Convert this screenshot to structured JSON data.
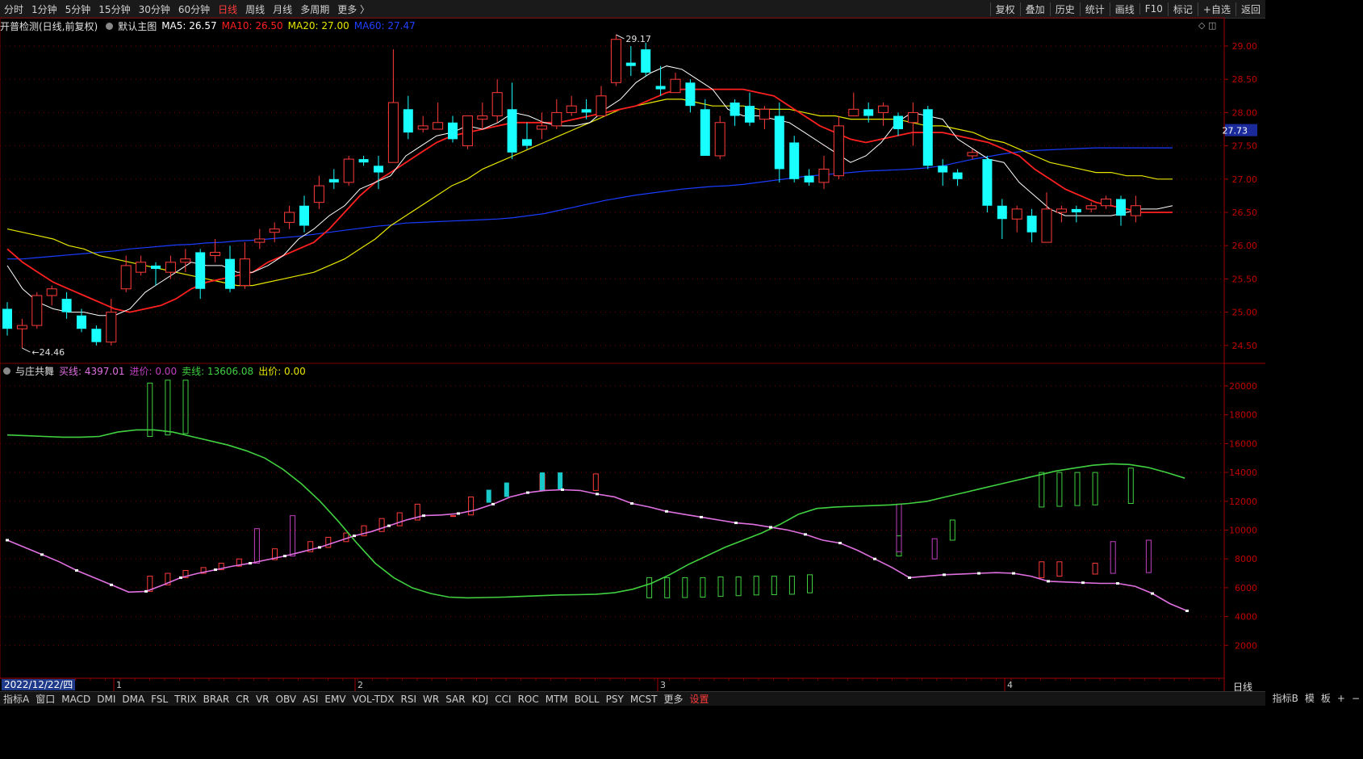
{
  "topbar": {
    "periods": [
      "分时",
      "1分钟",
      "5分钟",
      "15分钟",
      "30分钟",
      "60分钟",
      "日线",
      "周线",
      "月线",
      "多周期",
      "更多 〉"
    ],
    "active_period": "日线",
    "tools": [
      "复权",
      "叠加",
      "历史",
      "统计",
      "画线",
      "F10",
      "标记",
      "+自选",
      "返回"
    ]
  },
  "main_legend": {
    "stock": "开普检测(日线,前复权)",
    "chart_name": "默认主图",
    "ma5": "MA5: 26.57",
    "ma10": "MA10: 26.50",
    "ma20": "MA20: 27.00",
    "ma60": "MA60: 27.47"
  },
  "indicator_legend": {
    "name": "与庄共舞",
    "buy": "买线: 4397.01",
    "in": "进价: 0.00",
    "sell": "卖线: 13606.08",
    "out": "出价: 0.00"
  },
  "colors": {
    "up": "#ff3b3b",
    "down": "#19ffff",
    "ma5": "#ffffff",
    "ma10": "#ff2020",
    "ma20": "#e6e600",
    "ma60": "#1a3cff",
    "buy_line": "#e070e0",
    "sell_line": "#40d040"
  },
  "price_axis": {
    "labels": [
      "29.00",
      "28.50",
      "28.00",
      "27.50",
      "27.00",
      "26.50",
      "26.00",
      "25.50",
      "25.00",
      "24.50"
    ],
    "current": "27.73",
    "high_annot": "29.17",
    "low_annot": "24.46"
  },
  "ind_axis": {
    "labels": [
      "20000",
      "18000",
      "16000",
      "14000",
      "12000",
      "10000",
      "8000",
      "6000",
      "4000",
      "2000"
    ]
  },
  "time_axis": {
    "date": "2022/12/22/四",
    "months": [
      "1",
      "2",
      "3",
      "4"
    ],
    "period_label": "日线"
  },
  "chart_data": {
    "type": "candlestick",
    "candles": [
      [
        25.05,
        24.75,
        25.15,
        24.65
      ],
      [
        24.75,
        24.8,
        24.9,
        24.46
      ],
      [
        24.8,
        25.25,
        25.3,
        24.75
      ],
      [
        25.25,
        25.35,
        25.4,
        25.1
      ],
      [
        25.2,
        25.0,
        25.3,
        24.9
      ],
      [
        24.95,
        24.75,
        25.05,
        24.7
      ],
      [
        24.75,
        24.55,
        24.8,
        24.5
      ],
      [
        24.55,
        25.0,
        25.2,
        24.5
      ],
      [
        25.35,
        25.7,
        25.85,
        25.3
      ],
      [
        25.6,
        25.75,
        25.85,
        25.55
      ],
      [
        25.7,
        25.65,
        25.75,
        25.4
      ],
      [
        25.6,
        25.75,
        25.85,
        25.5
      ],
      [
        25.75,
        25.8,
        25.95,
        25.6
      ],
      [
        25.9,
        25.35,
        25.95,
        25.2
      ],
      [
        25.85,
        25.9,
        26.1,
        25.75
      ],
      [
        25.8,
        25.35,
        26.0,
        25.3
      ],
      [
        25.4,
        25.8,
        26.05,
        25.35
      ],
      [
        26.05,
        26.1,
        26.25,
        25.95
      ],
      [
        26.2,
        26.25,
        26.35,
        26.05
      ],
      [
        26.35,
        26.5,
        26.6,
        26.25
      ],
      [
        26.6,
        26.3,
        26.75,
        26.2
      ],
      [
        26.65,
        26.9,
        27.05,
        26.55
      ],
      [
        27.0,
        26.95,
        27.15,
        26.85
      ],
      [
        26.95,
        27.3,
        27.35,
        26.9
      ],
      [
        27.3,
        27.25,
        27.35,
        27.2
      ],
      [
        27.2,
        27.1,
        27.35,
        26.85
      ],
      [
        27.25,
        28.15,
        28.95,
        27.25
      ],
      [
        28.05,
        27.7,
        28.25,
        27.6
      ],
      [
        27.75,
        27.8,
        27.95,
        27.7
      ],
      [
        27.75,
        27.85,
        28.15,
        27.75
      ],
      [
        27.85,
        27.6,
        27.95,
        27.55
      ],
      [
        27.5,
        27.95,
        27.95,
        27.45
      ],
      [
        27.9,
        27.95,
        28.15,
        27.75
      ],
      [
        27.95,
        28.3,
        28.5,
        27.85
      ],
      [
        28.05,
        27.4,
        28.45,
        27.3
      ],
      [
        27.6,
        27.5,
        27.85,
        27.45
      ],
      [
        27.75,
        27.8,
        28.0,
        27.6
      ],
      [
        27.8,
        28.0,
        28.2,
        27.75
      ],
      [
        28.0,
        28.1,
        28.25,
        27.95
      ],
      [
        28.05,
        28.0,
        28.2,
        27.9
      ],
      [
        27.95,
        28.25,
        28.4,
        27.95
      ],
      [
        28.45,
        29.1,
        29.17,
        28.4
      ],
      [
        28.75,
        28.7,
        29.0,
        28.55
      ],
      [
        28.95,
        28.6,
        29.05,
        28.55
      ],
      [
        28.4,
        28.35,
        28.7,
        28.25
      ],
      [
        28.3,
        28.5,
        28.6,
        28.3
      ],
      [
        28.45,
        28.1,
        28.5,
        28.0
      ],
      [
        28.05,
        27.35,
        28.2,
        27.35
      ],
      [
        27.35,
        27.85,
        27.95,
        27.3
      ],
      [
        28.15,
        27.95,
        28.2,
        27.8
      ],
      [
        28.1,
        27.85,
        28.3,
        27.8
      ],
      [
        27.9,
        28.05,
        28.1,
        27.75
      ],
      [
        27.95,
        27.15,
        28.15,
        26.95
      ],
      [
        27.55,
        27.0,
        27.65,
        26.95
      ],
      [
        27.05,
        26.95,
        27.15,
        26.9
      ],
      [
        26.95,
        27.15,
        27.35,
        26.85
      ],
      [
        27.05,
        27.8,
        27.95,
        27.0
      ],
      [
        27.95,
        28.05,
        28.3,
        27.95
      ],
      [
        28.05,
        27.95,
        28.15,
        27.85
      ],
      [
        28.0,
        28.1,
        28.15,
        27.8
      ],
      [
        27.95,
        27.75,
        28.0,
        27.65
      ],
      [
        27.85,
        28.0,
        28.15,
        27.5
      ],
      [
        28.05,
        27.2,
        28.1,
        27.15
      ],
      [
        27.2,
        27.1,
        27.3,
        26.9
      ],
      [
        27.1,
        27.0,
        27.15,
        26.9
      ],
      [
        27.35,
        27.4,
        27.45,
        27.3
      ],
      [
        27.3,
        26.6,
        27.35,
        26.5
      ],
      [
        26.6,
        26.4,
        26.7,
        26.1
      ],
      [
        26.4,
        26.55,
        26.6,
        26.2
      ],
      [
        26.45,
        26.2,
        26.55,
        26.05
      ],
      [
        26.05,
        26.55,
        26.8,
        26.05
      ],
      [
        26.5,
        26.55,
        26.6,
        26.35
      ],
      [
        26.55,
        26.5,
        26.6,
        26.35
      ],
      [
        26.55,
        26.6,
        26.65,
        26.5
      ],
      [
        26.6,
        26.7,
        26.75,
        26.55
      ],
      [
        26.7,
        26.45,
        26.75,
        26.3
      ],
      [
        26.45,
        26.6,
        26.75,
        26.35
      ]
    ],
    "ma5": [
      25.7,
      25.35,
      25.15,
      25.05,
      25.0,
      25.0,
      24.95,
      24.95,
      25.05,
      25.3,
      25.45,
      25.6,
      25.75,
      25.7,
      25.7,
      25.6,
      25.6,
      25.7,
      25.85,
      26.1,
      26.25,
      26.45,
      26.6,
      26.85,
      26.95,
      27.05,
      27.35,
      27.5,
      27.65,
      27.7,
      27.8,
      27.75,
      27.85,
      28.0,
      27.95,
      27.85,
      27.8,
      27.8,
      27.85,
      28.05,
      28.2,
      28.45,
      28.6,
      28.7,
      28.65,
      28.5,
      28.35,
      28.05,
      27.95,
      27.95,
      27.9,
      27.85,
      27.7,
      27.55,
      27.4,
      27.25,
      27.35,
      27.55,
      27.85,
      28.0,
      27.95,
      27.9,
      27.6,
      27.45,
      27.3,
      27.25,
      26.95,
      26.75,
      26.55,
      26.45,
      26.45,
      26.45,
      26.45,
      26.5,
      26.55,
      26.55,
      26.6
    ],
    "ma10": [
      25.95,
      25.75,
      25.6,
      25.45,
      25.35,
      25.25,
      25.15,
      25.05,
      25.0,
      25.05,
      25.1,
      25.2,
      25.35,
      25.45,
      25.5,
      25.55,
      25.6,
      25.75,
      25.85,
      25.95,
      26.05,
      26.25,
      26.5,
      26.75,
      26.95,
      27.1,
      27.25,
      27.4,
      27.55,
      27.65,
      27.7,
      27.75,
      27.8,
      27.85,
      27.85,
      27.85,
      27.85,
      27.9,
      27.95,
      28.0,
      28.05,
      28.1,
      28.2,
      28.3,
      28.35,
      28.35,
      28.35,
      28.35,
      28.35,
      28.3,
      28.25,
      28.1,
      27.95,
      27.8,
      27.7,
      27.6,
      27.55,
      27.6,
      27.65,
      27.7,
      27.7,
      27.7,
      27.65,
      27.6,
      27.55,
      27.45,
      27.35,
      27.15,
      27.0,
      26.85,
      26.75,
      26.65,
      26.6,
      26.55,
      26.5,
      26.5,
      26.5
    ],
    "ma20": [
      26.25,
      26.2,
      26.15,
      26.1,
      26.0,
      25.95,
      25.85,
      25.8,
      25.75,
      25.7,
      25.65,
      25.6,
      25.55,
      25.5,
      25.45,
      25.4,
      25.4,
      25.45,
      25.5,
      25.55,
      25.6,
      25.7,
      25.8,
      25.95,
      26.1,
      26.3,
      26.45,
      26.6,
      26.75,
      26.9,
      27.0,
      27.15,
      27.25,
      27.35,
      27.45,
      27.55,
      27.65,
      27.75,
      27.85,
      27.95,
      28.05,
      28.1,
      28.15,
      28.2,
      28.2,
      28.15,
      28.1,
      28.1,
      28.1,
      28.05,
      28.05,
      28.05,
      28.0,
      27.95,
      27.95,
      27.9,
      27.9,
      27.9,
      27.9,
      27.85,
      27.8,
      27.8,
      27.75,
      27.7,
      27.6,
      27.55,
      27.45,
      27.35,
      27.25,
      27.2,
      27.15,
      27.1,
      27.1,
      27.05,
      27.05,
      27.0,
      27.0
    ],
    "ma60": [
      25.8,
      25.8,
      25.82,
      25.84,
      25.86,
      25.88,
      25.9,
      25.92,
      25.95,
      25.97,
      25.99,
      26.01,
      26.02,
      26.04,
      26.05,
      26.07,
      26.08,
      26.1,
      26.12,
      26.14,
      26.17,
      26.2,
      26.23,
      26.26,
      26.29,
      26.31,
      26.34,
      26.35,
      26.36,
      26.37,
      26.38,
      26.39,
      26.4,
      26.42,
      26.45,
      26.48,
      26.53,
      26.58,
      26.63,
      26.68,
      26.72,
      26.76,
      26.79,
      26.82,
      26.85,
      26.87,
      26.89,
      26.9,
      26.92,
      26.95,
      26.98,
      27.01,
      27.04,
      27.06,
      27.08,
      27.1,
      27.12,
      27.13,
      27.14,
      27.15,
      27.17,
      27.2,
      27.25,
      27.3,
      27.34,
      27.38,
      27.41,
      27.43,
      27.44,
      27.45,
      27.46,
      27.47,
      27.47,
      27.47,
      27.47,
      27.47,
      27.47
    ],
    "sell_line": [
      16600,
      16550,
      16500,
      16450,
      16450,
      16500,
      16800,
      16950,
      16950,
      16800,
      16500,
      16200,
      15900,
      15500,
      15000,
      14200,
      13200,
      12000,
      10600,
      9100,
      7700,
      6700,
      6000,
      5600,
      5350,
      5300,
      5320,
      5350,
      5400,
      5450,
      5500,
      5520,
      5550,
      5650,
      5900,
      6300,
      6900,
      7600,
      8200,
      8800,
      9300,
      9800,
      10400,
      11100,
      11500,
      11600,
      11650,
      11700,
      11750,
      11850,
      12000,
      12300,
      12600,
      12900,
      13200,
      13500,
      13800,
      14100,
      14300,
      14500,
      14600,
      14550,
      14350,
      14000,
      13600
    ],
    "buy_line": [
      9300,
      8800,
      8300,
      7800,
      7200,
      6700,
      6200,
      5700,
      5750,
      6200,
      6700,
      7000,
      7250,
      7500,
      7700,
      7950,
      8200,
      8500,
      8800,
      9200,
      9600,
      9900,
      10300,
      10700,
      11000,
      11050,
      11150,
      11400,
      11800,
      12300,
      12600,
      12750,
      12800,
      12750,
      12500,
      12300,
      11850,
      11600,
      11300,
      11100,
      10900,
      10700,
      10500,
      10400,
      10200,
      10000,
      9700,
      9300,
      9100,
      8600,
      8000,
      7400,
      6700,
      6800,
      6900,
      6950,
      7000,
      7050,
      7000,
      6800,
      6450,
      6400,
      6350,
      6300,
      6300,
      6100,
      5600,
      4900,
      4400
    ],
    "hist_green": [
      [
        8,
        16500,
        20200
      ],
      [
        9,
        16600,
        20400
      ],
      [
        10,
        16700,
        20400
      ],
      [
        36,
        5300,
        6700
      ],
      [
        37,
        5300,
        6700
      ],
      [
        38,
        5320,
        6700
      ],
      [
        39,
        5350,
        6700
      ],
      [
        40,
        5400,
        6750
      ],
      [
        41,
        5450,
        6750
      ],
      [
        42,
        5500,
        6800
      ],
      [
        43,
        5520,
        6800
      ],
      [
        44,
        5550,
        6800
      ],
      [
        45,
        5650,
        6900
      ],
      [
        50,
        8200,
        9600
      ],
      [
        53,
        9300,
        10700
      ],
      [
        58,
        11600,
        14000
      ],
      [
        59,
        11650,
        14000
      ],
      [
        60,
        11700,
        14000
      ],
      [
        61,
        11750,
        14000
      ],
      [
        63,
        11850,
        14300
      ]
    ],
    "hist_cyan": [
      [
        27,
        11900,
        12800
      ],
      [
        28,
        12300,
        13300
      ],
      [
        30,
        12750,
        14000
      ],
      [
        31,
        12800,
        14000
      ]
    ],
    "hist_red": [
      [
        8,
        5750,
        6800
      ],
      [
        9,
        6200,
        7000
      ],
      [
        10,
        6700,
        7200
      ],
      [
        11,
        7000,
        7400
      ],
      [
        12,
        7250,
        7700
      ],
      [
        13,
        7500,
        8000
      ],
      [
        15,
        7950,
        8700
      ],
      [
        17,
        8500,
        9200
      ],
      [
        18,
        8800,
        9500
      ],
      [
        19,
        9200,
        9800
      ],
      [
        20,
        9600,
        10300
      ],
      [
        21,
        9900,
        10800
      ],
      [
        22,
        10300,
        11200
      ],
      [
        23,
        10700,
        11800
      ],
      [
        25,
        11000,
        11000
      ],
      [
        26,
        11050,
        12300
      ],
      [
        30,
        12750,
        13900
      ],
      [
        33,
        12750,
        13900
      ],
      [
        58,
        6700,
        7800
      ],
      [
        59,
        6800,
        7800
      ],
      [
        61,
        6950,
        7700
      ]
    ],
    "hist_purple": [
      [
        14,
        7700,
        10100
      ],
      [
        16,
        8200,
        11000
      ],
      [
        50,
        8500,
        11800
      ],
      [
        52,
        8000,
        9400
      ],
      [
        62,
        7000,
        9200
      ],
      [
        64,
        7050,
        9300
      ]
    ]
  },
  "bottombar": {
    "items": [
      "指标A",
      "窗口",
      "MACD",
      "DMI",
      "DMA",
      "FSL",
      "TRIX",
      "BRAR",
      "CR",
      "VR",
      "OBV",
      "ASI",
      "EMV",
      "VOL-TDX",
      "RSI",
      "WR",
      "SAR",
      "KDJ",
      "CCI",
      "ROC",
      "MTM",
      "BOLL",
      "PSY",
      "MCST",
      "更多",
      "设置"
    ],
    "active": "设置",
    "right": [
      "指标B",
      "模",
      "板",
      "+",
      "−"
    ]
  },
  "corner_icons": "◇ ◫"
}
